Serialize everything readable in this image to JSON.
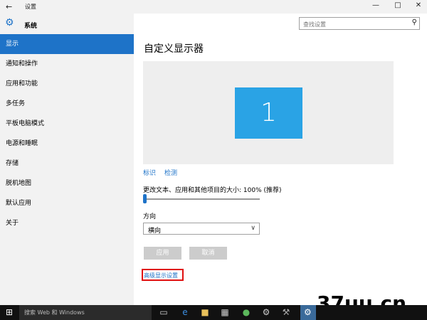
{
  "window": {
    "title": "设置",
    "back_icon": "←",
    "minimize_icon": "—",
    "maximize_icon": "□",
    "close_icon": "✕"
  },
  "sidebar": {
    "header_icon": "⚙",
    "header_label": "系统",
    "items": [
      {
        "label": "显示",
        "active": true
      },
      {
        "label": "通知和操作"
      },
      {
        "label": "应用和功能"
      },
      {
        "label": "多任务"
      },
      {
        "label": "平板电脑模式"
      },
      {
        "label": "电源和睡眠"
      },
      {
        "label": "存储"
      },
      {
        "label": "脱机地图"
      },
      {
        "label": "默认应用"
      },
      {
        "label": "关于"
      }
    ]
  },
  "search": {
    "placeholder": "查找设置",
    "icon": "⚲"
  },
  "main": {
    "title": "自定义显示器",
    "monitor_number": "1",
    "identify_link": "标识",
    "detect_link": "检测",
    "scale_label": "更改文本、应用和其他项目的大小: 100% (推荐)",
    "scale_value_percent": 0,
    "orientation_label": "方向",
    "orientation_value": "横向",
    "apply_button": "应用",
    "cancel_button": "取消",
    "advanced_link": "高级显示设置"
  },
  "taskbar": {
    "start_icon": "⊞",
    "search_text": "搜索 Web 和 Windows"
  },
  "watermark": "37uu.cn",
  "colors": {
    "accent": "#1e73c8",
    "monitor": "#2aa3e5",
    "highlight_border": "#e01010"
  }
}
